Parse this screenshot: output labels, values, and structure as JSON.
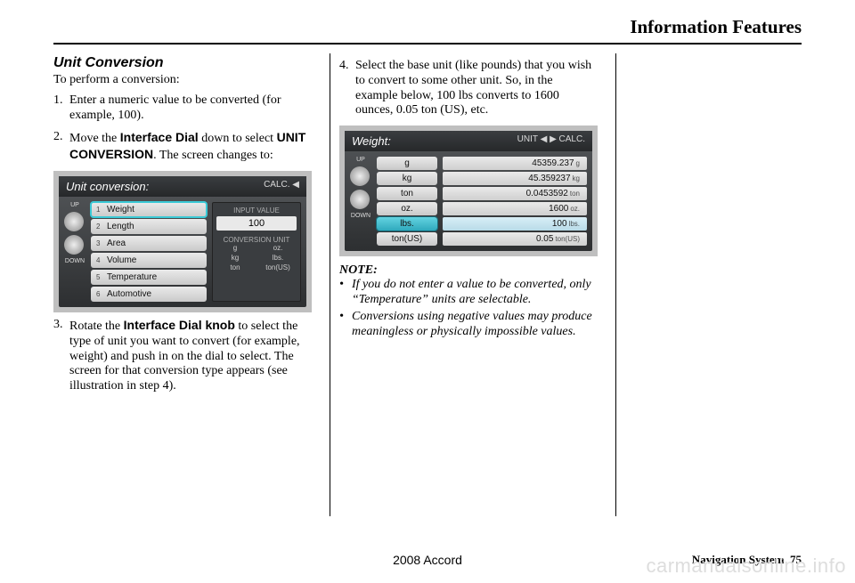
{
  "header": {
    "title": "Information Features"
  },
  "section": {
    "subhead": "Unit Conversion",
    "intro": "To perform a conversion:",
    "steps": [
      {
        "num": "1.",
        "text": "Enter a numeric value to be converted (for example, 100)."
      },
      {
        "num": "2.",
        "pre": "Move the ",
        "bold1": "Interface Dial",
        "mid": " down to select ",
        "bold2": "UNIT CONVERSION",
        "post": ". The screen changes to:"
      },
      {
        "num": "3.",
        "pre": "Rotate the ",
        "bold1": "Interface Dial knob",
        "post": " to select the type of unit you want to convert (for example, weight) and push in on the dial to select. The screen for that conversion type appears (see illustration in step 4)."
      },
      {
        "num": "4.",
        "text": "Select the base unit (like pounds) that you wish to convert to some other unit. So, in the example below, 100 lbs converts to 1600 ounces, 0.05 ton (US), etc."
      }
    ],
    "note_head": "NOTE:",
    "notes": [
      "If you do not enter a value to be converted, only “Temperature” units are selectable.",
      "Conversions using negative values may produce meaningless or physically impossible values."
    ]
  },
  "shot1": {
    "title": "Unit conversion:",
    "right_label": "CALC. ◀",
    "dial_up": "UP",
    "dial_down": "DOWN",
    "items": [
      {
        "idx": "1",
        "label": "Weight",
        "sel": true
      },
      {
        "idx": "2",
        "label": "Length"
      },
      {
        "idx": "3",
        "label": "Area"
      },
      {
        "idx": "4",
        "label": "Volume"
      },
      {
        "idx": "5",
        "label": "Temperature"
      },
      {
        "idx": "6",
        "label": "Automotive"
      }
    ],
    "input_label": "INPUT VALUE",
    "input_value": "100",
    "conv_label": "CONVERSION UNIT",
    "conv_units": [
      "g",
      "oz.",
      "kg",
      "lbs.",
      "ton",
      "ton(US)"
    ]
  },
  "shot2": {
    "title": "Weight:",
    "right_label": "UNIT ◀        ▶ CALC.",
    "dial_up": "UP",
    "dial_down": "DOWN",
    "units": [
      {
        "label": "g"
      },
      {
        "label": "kg"
      },
      {
        "label": "ton"
      },
      {
        "label": "oz."
      },
      {
        "label": "lbs.",
        "sel": true
      },
      {
        "label": "ton(US)"
      }
    ],
    "results": [
      {
        "val": "45359.237",
        "unit": "g"
      },
      {
        "val": "45.359237",
        "unit": "kg"
      },
      {
        "val": "0.0453592",
        "unit": "ton"
      },
      {
        "val": "1600",
        "unit": "oz."
      },
      {
        "val": "100",
        "unit": "lbs.",
        "hl": true
      },
      {
        "val": "0.05",
        "unit": "ton(US)"
      }
    ]
  },
  "footer": {
    "model": "2008  Accord",
    "sec": "Navigation System",
    "page": "75"
  },
  "watermark": "carmanualsonline.info"
}
